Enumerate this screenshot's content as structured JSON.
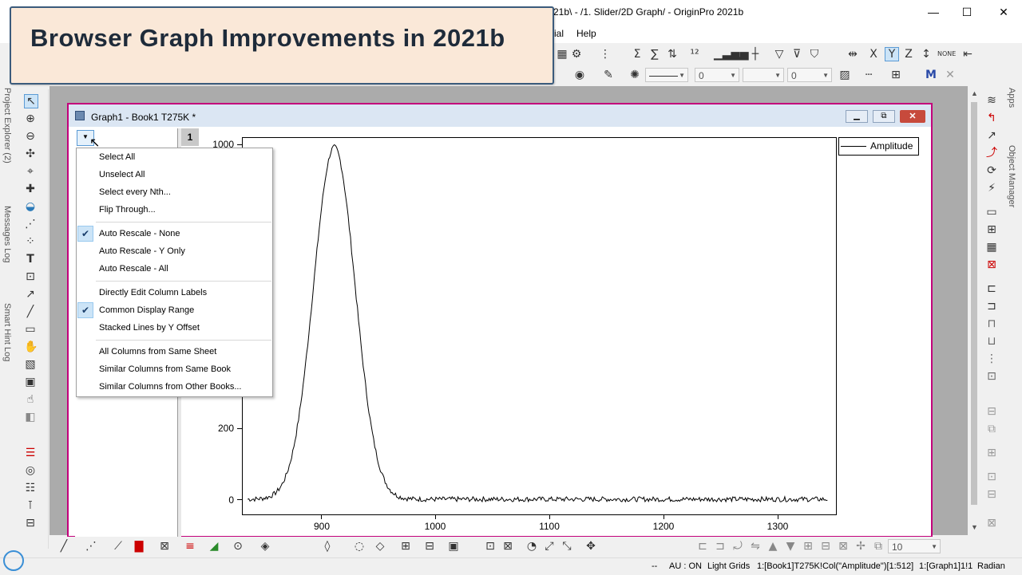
{
  "window": {
    "title": "21b\\ - /1. Slider/2D Graph/ - OriginPro 2021b",
    "minimize": "—",
    "maximize": "☐",
    "close": "✕"
  },
  "menu": {
    "items": [
      {
        "label": "ial"
      },
      {
        "label": "Help"
      }
    ]
  },
  "toolbar": {
    "line_width": "0",
    "pattern_width": "0",
    "bottom_zoom": "10"
  },
  "banner": {
    "title": "Browser Graph Improvements in 2021b"
  },
  "dock": {
    "left_tabs": [
      "Project Explorer (2)",
      "Messages Log",
      "Smart Hint Log"
    ],
    "right_tabs": [
      "Apps",
      "Object Manager"
    ]
  },
  "graph_window": {
    "title": "Graph1 - Book1 T275K *",
    "layer_index": "1"
  },
  "plot": {
    "y_ticks": [
      "1000",
      "200",
      "0"
    ],
    "x_ticks": [
      "900",
      "1000",
      "1100",
      "1200",
      "1300"
    ],
    "legend_label": "Amplitude"
  },
  "context_menu": {
    "groups": [
      [
        {
          "label": "Select All",
          "checked": false
        },
        {
          "label": "Unselect All",
          "checked": false
        },
        {
          "label": "Select every Nth...",
          "checked": false
        },
        {
          "label": "Flip Through...",
          "checked": false
        }
      ],
      [
        {
          "label": "Auto Rescale - None",
          "checked": true
        },
        {
          "label": "Auto Rescale - Y Only",
          "checked": false
        },
        {
          "label": "Auto Rescale - All",
          "checked": false
        }
      ],
      [
        {
          "label": "Directly Edit Column Labels",
          "checked": false
        },
        {
          "label": "Common Display Range",
          "checked": true
        },
        {
          "label": "Stacked Lines by Y Offset",
          "checked": false
        }
      ],
      [
        {
          "label": "All Columns from Same Sheet",
          "checked": false
        },
        {
          "label": "Similar Columns from Same Book",
          "checked": false
        },
        {
          "label": "Similar Columns from Other Books...",
          "checked": false
        }
      ]
    ]
  },
  "status": {
    "dashes": "--",
    "au": "AU : ON",
    "theme": "Light Grids",
    "ref": "1:[Book1]T275K!Col(\"Amplitude\")[1:512]",
    "layer": "1:[Graph1]1!1",
    "units": "Radian"
  }
}
